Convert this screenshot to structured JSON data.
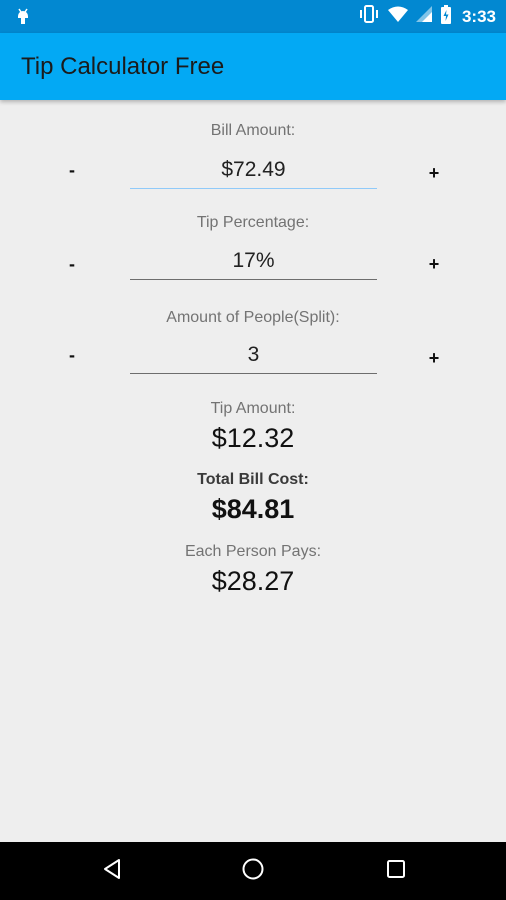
{
  "status_bar": {
    "time": "3:33",
    "icons": [
      "android-debug-icon",
      "vibrate-icon",
      "wifi-icon",
      "signal-icon",
      "battery-icon"
    ]
  },
  "app_bar": {
    "title": "Tip Calculator Free"
  },
  "bill": {
    "label": "Bill Amount:",
    "value": "$72.49",
    "minus": "-",
    "plus": "+"
  },
  "tip": {
    "label": "Tip Percentage:",
    "value": "17%",
    "minus": "-",
    "plus": "+"
  },
  "people": {
    "label": "Amount of People(Split):",
    "value": "3",
    "minus": "-",
    "plus": "+"
  },
  "results": {
    "tip_label": "Tip Amount:",
    "tip_value": "$12.32",
    "total_label": "Total Bill Cost:",
    "total_value": "$84.81",
    "each_label": "Each Person Pays:",
    "each_value": "$28.27"
  },
  "nav_bar": {
    "icons": [
      "back-icon",
      "home-icon",
      "recents-icon"
    ]
  },
  "colors": {
    "status_bar": "#0288d1",
    "app_bar": "#03a9f4",
    "background": "#eeeeee",
    "focus_underline": "#90caf9"
  }
}
